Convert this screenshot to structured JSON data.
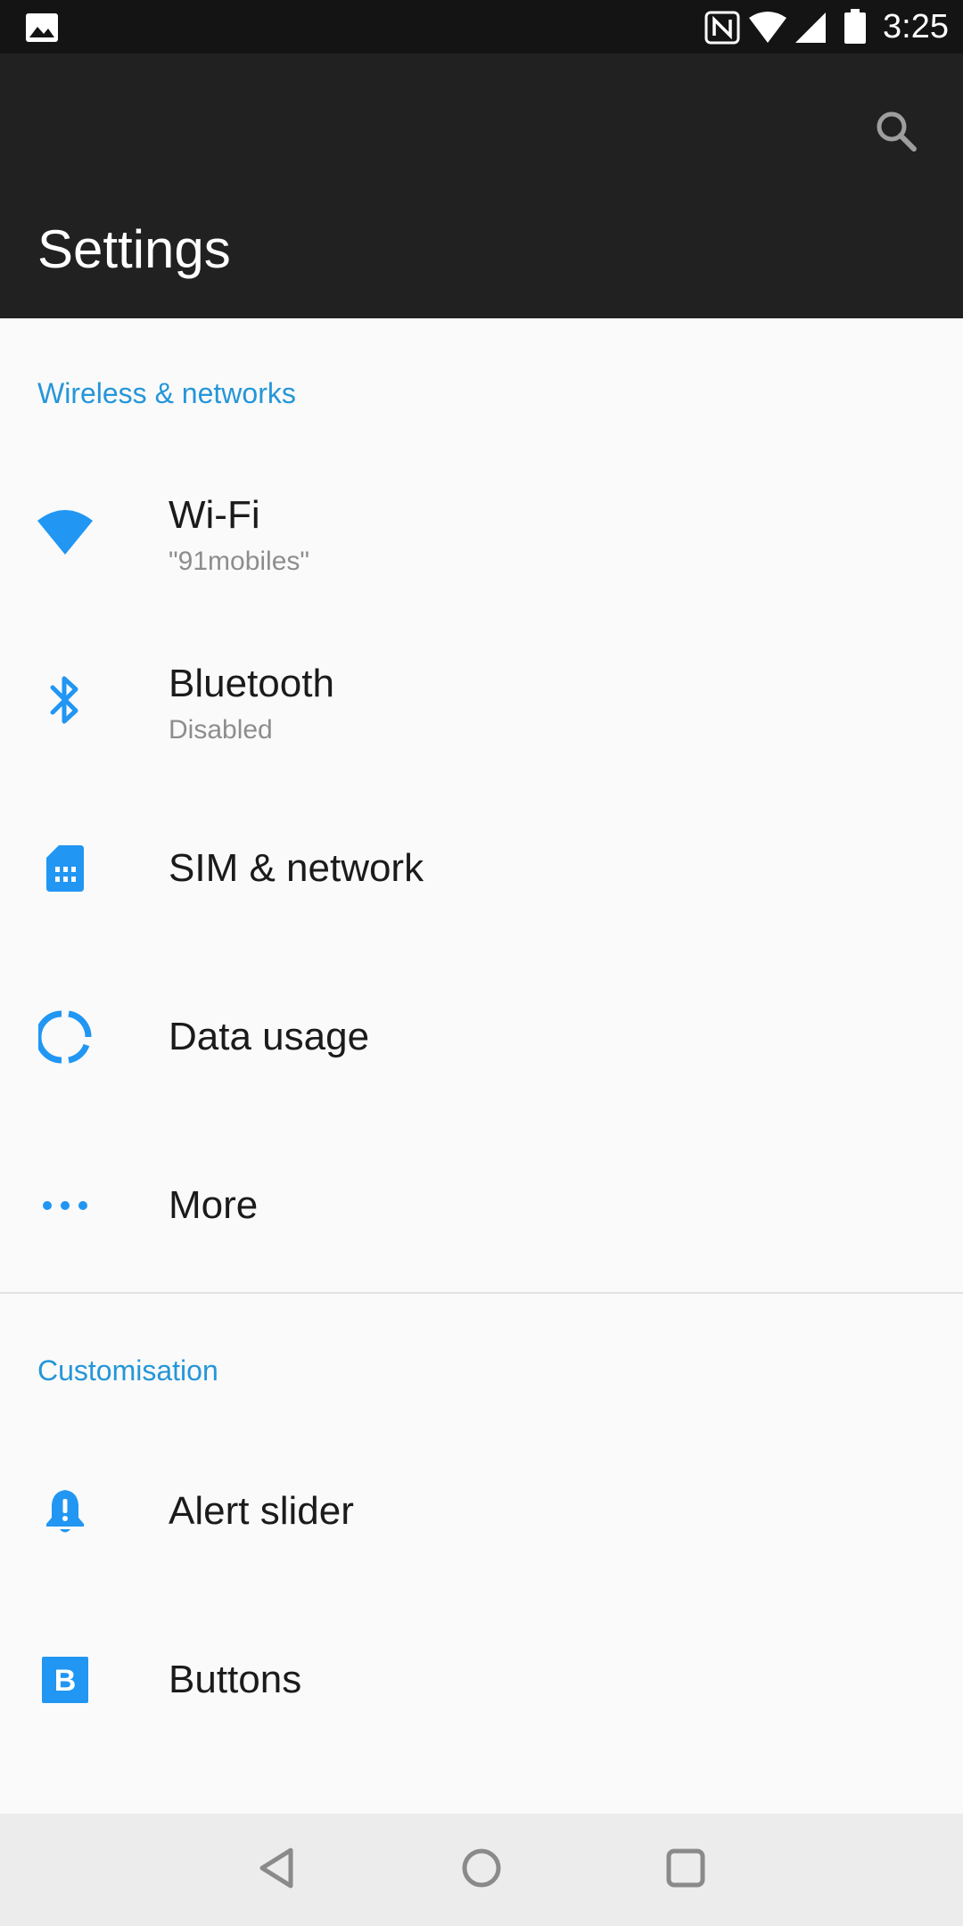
{
  "status_bar": {
    "time": "3:25",
    "icons": [
      "gallery-notification-icon",
      "nfc-icon",
      "wifi-signal-icon",
      "cell-signal-icon",
      "battery-icon"
    ]
  },
  "app_bar": {
    "title": "Settings",
    "search_icon": "search-icon"
  },
  "sections": [
    {
      "header": "Wireless & networks",
      "items": [
        {
          "label": "Wi-Fi",
          "subtitle": "\"91mobiles\"",
          "icon": "wifi-icon"
        },
        {
          "label": "Bluetooth",
          "subtitle": "Disabled",
          "icon": "bluetooth-icon"
        },
        {
          "label": "SIM & network",
          "icon": "sim-card-icon"
        },
        {
          "label": "Data usage",
          "icon": "data-usage-icon"
        },
        {
          "label": "More",
          "icon": "more-dots-icon"
        }
      ]
    },
    {
      "header": "Customisation",
      "items": [
        {
          "label": "Alert slider",
          "icon": "alert-bell-icon"
        },
        {
          "label": "Buttons",
          "icon": "buttons-b-icon"
        }
      ]
    }
  ],
  "nav_bar": {
    "buttons": [
      "back-icon",
      "home-icon",
      "recents-icon"
    ]
  },
  "colors": {
    "accent": "#2596d8",
    "icon_blue": "#2196f3",
    "app_bar": "#212121",
    "status_bar": "#141414",
    "background": "#fafafa"
  }
}
